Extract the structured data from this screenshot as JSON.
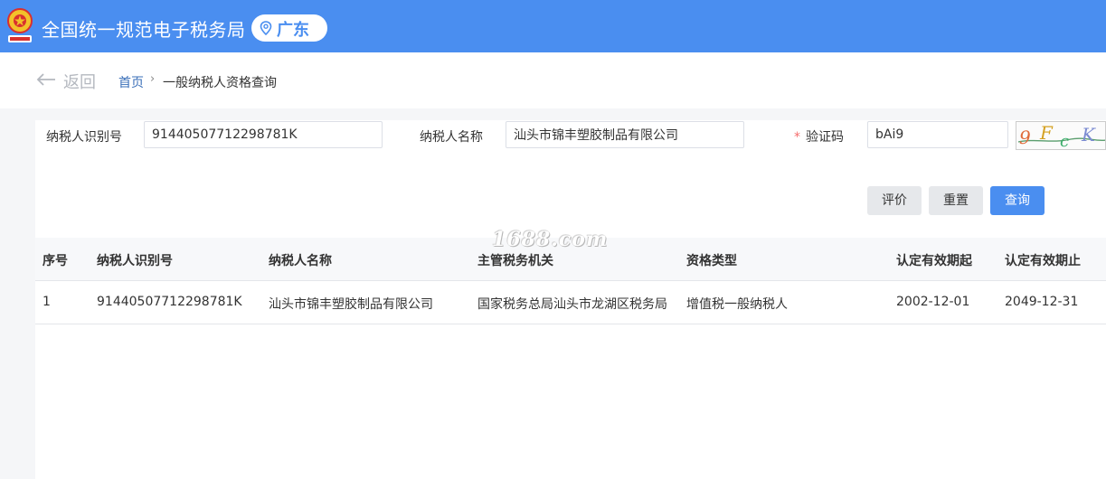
{
  "header": {
    "title": "全国统一规范电子税务局",
    "region": "广东",
    "emblem_icon": "tax-emblem-icon",
    "location_icon": "location-pin-icon"
  },
  "nav": {
    "back_label": "返回",
    "breadcrumb": {
      "home": "首页",
      "separator": "›",
      "current": "一般纳税人资格查询"
    }
  },
  "form": {
    "taxpayer_id_label": "纳税人识别号",
    "taxpayer_id_value": "91440507712298781K",
    "taxpayer_name_label": "纳税人名称",
    "taxpayer_name_value": "汕头市锦丰塑胶制品有限公司",
    "captcha_required_mark": "*",
    "captcha_label": "验证码",
    "captcha_value": "bAi9",
    "captcha_image_text": "9FcK"
  },
  "buttons": {
    "evaluate": "评价",
    "reset": "重置",
    "query": "查询"
  },
  "table": {
    "headers": [
      "序号",
      "纳税人识别号",
      "纳税人名称",
      "主管税务机关",
      "资格类型",
      "认定有效期起",
      "认定有效期止"
    ],
    "rows": [
      [
        "1",
        "91440507712298781K",
        "汕头市锦丰塑胶制品有限公司",
        "国家税务总局汕头市龙湖区税务局",
        "增值税一般纳税人",
        "2002-12-01",
        "2049-12-31"
      ]
    ]
  },
  "watermark": "1688.com",
  "colors": {
    "header_bg": "#4a8ef0",
    "primary_button": "#4a8ef0",
    "required_mark": "#f56c6c"
  }
}
